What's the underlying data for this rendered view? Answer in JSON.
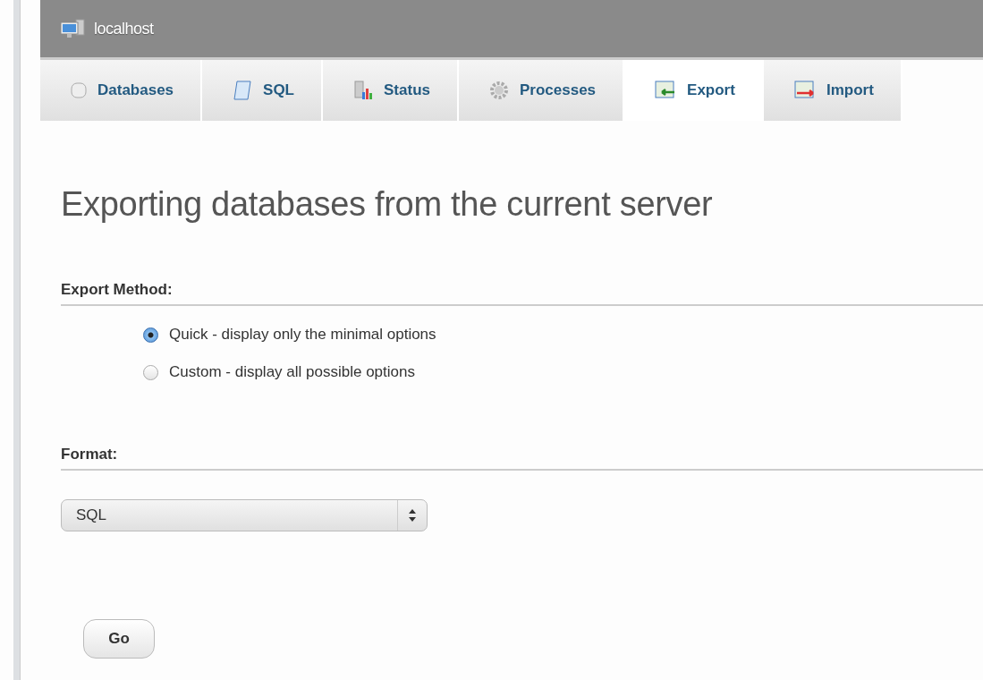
{
  "server": {
    "title": "localhost"
  },
  "tabs": [
    {
      "label": "Databases",
      "selected": false
    },
    {
      "label": "SQL",
      "selected": false
    },
    {
      "label": "Status",
      "selected": false
    },
    {
      "label": "Processes",
      "selected": false
    },
    {
      "label": "Export",
      "selected": true
    },
    {
      "label": "Import",
      "selected": false
    }
  ],
  "heading": "Exporting databases from the current server",
  "export_method": {
    "title": "Export Method:",
    "options": [
      {
        "label": "Quick - display only the minimal options",
        "selected": true
      },
      {
        "label": "Custom - display all possible options",
        "selected": false
      }
    ]
  },
  "format": {
    "title": "Format:",
    "value": "SQL"
  },
  "go_button": "Go"
}
